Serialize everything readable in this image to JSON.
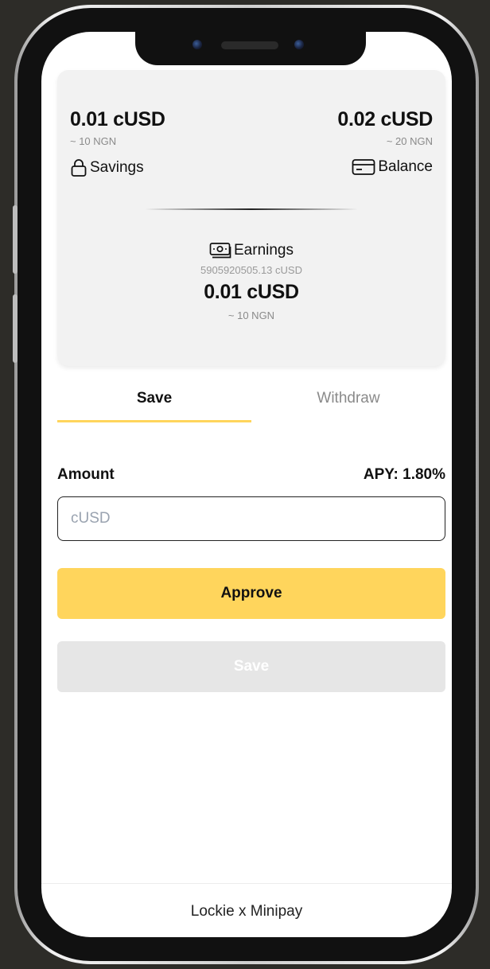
{
  "card": {
    "savings": {
      "amount": "0.01 cUSD",
      "fiat": "~ 10 NGN",
      "label": "Savings",
      "icon": "lock-icon"
    },
    "balance": {
      "amount": "0.02 cUSD",
      "fiat": "~ 20 NGN",
      "label": "Balance",
      "icon": "credit-card-icon"
    },
    "earnings": {
      "label": "Earnings",
      "raw": "5905920505.13 cUSD",
      "amount": "0.01 cUSD",
      "fiat": "~ 10 NGN",
      "icon": "banknote-icon"
    }
  },
  "tabs": [
    {
      "label": "Save",
      "active": true
    },
    {
      "label": "Withdraw",
      "active": false
    }
  ],
  "form": {
    "amount_label": "Amount",
    "apy_label": "APY: 1.80%",
    "input_value": "",
    "input_placeholder": "cUSD",
    "approve_label": "Approve",
    "save_label": "Save"
  },
  "footer": {
    "text": "Lockie x Minipay"
  },
  "colors": {
    "accent": "#ffd55c",
    "card_bg": "#f2f2f2",
    "disabled_bg": "#e6e6e6"
  }
}
